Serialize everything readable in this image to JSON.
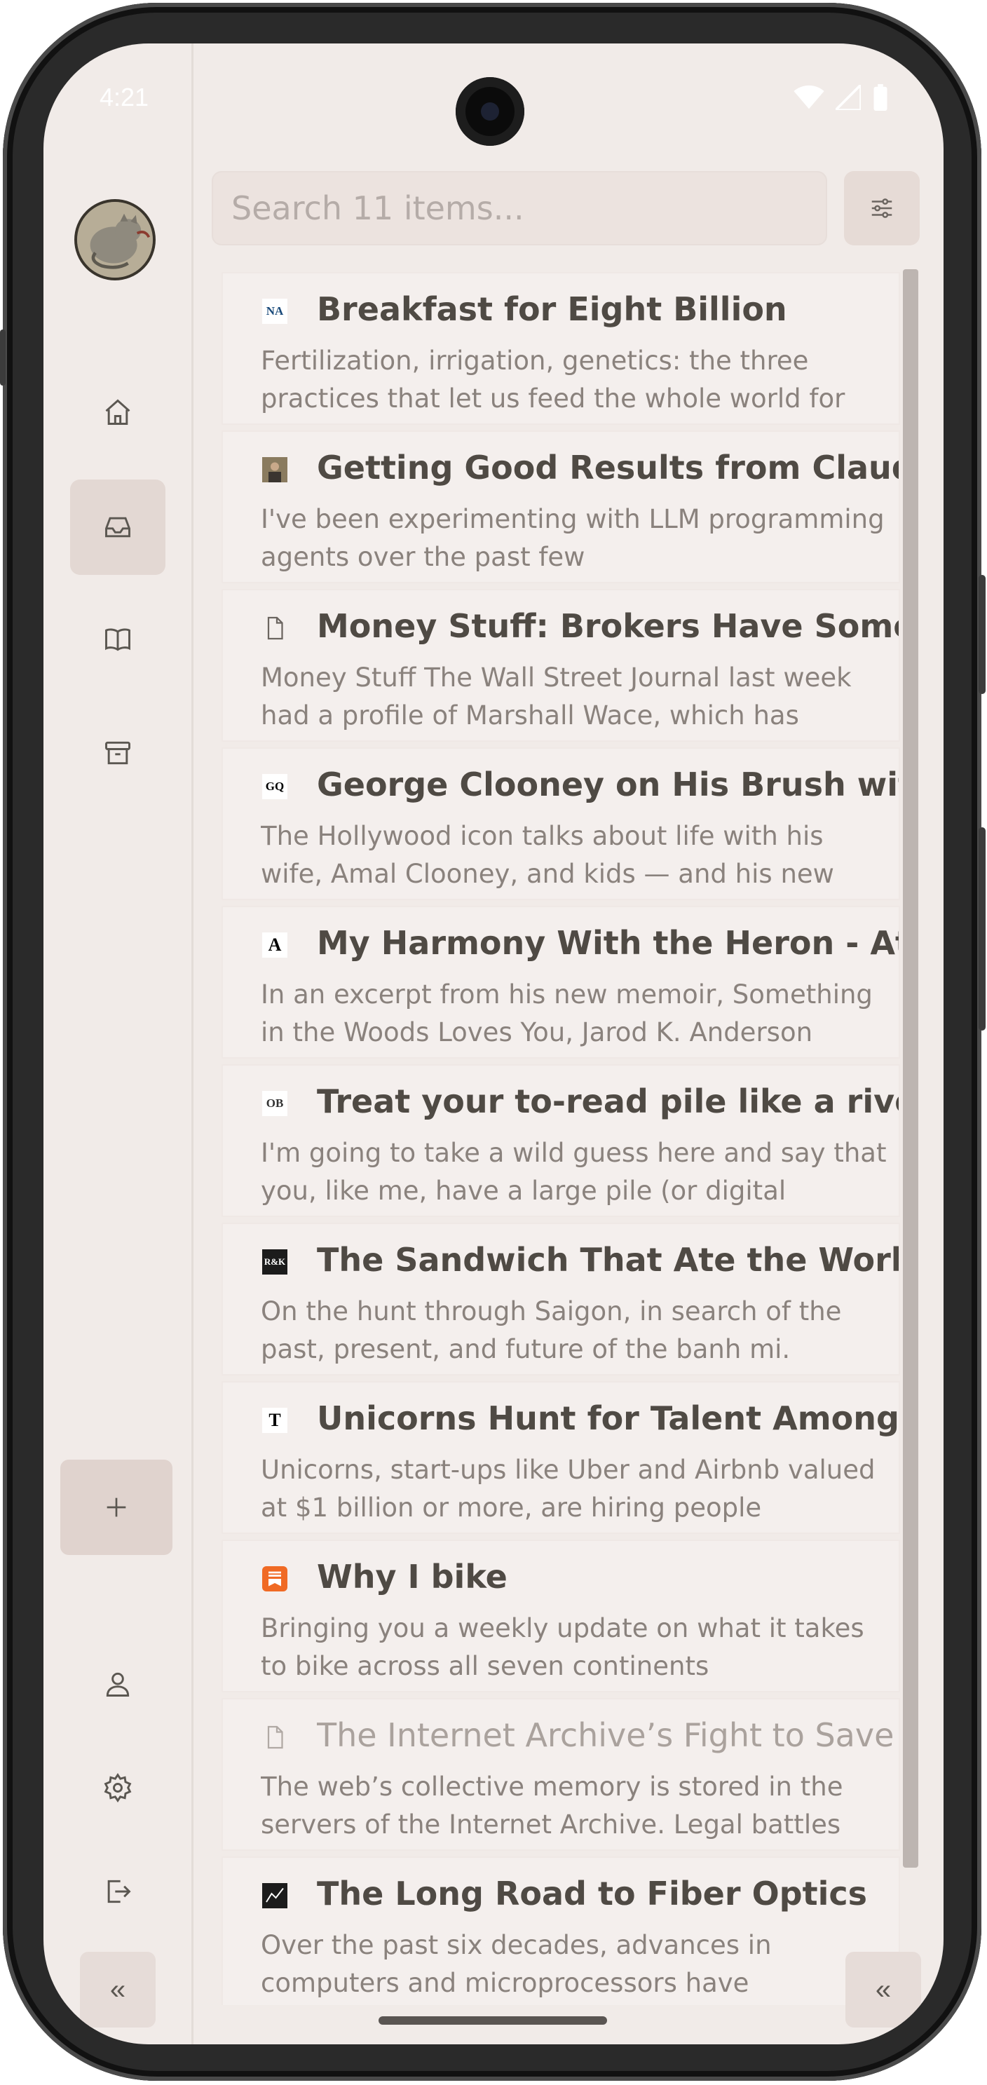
{
  "status_bar": {
    "time": "4:21"
  },
  "search": {
    "placeholder": "Search 11 items..."
  },
  "nav": {
    "home": "home",
    "inbox": "inbox",
    "library": "library",
    "archive": "archive",
    "add": "add",
    "profile": "profile",
    "settings": "settings",
    "logout": "logout"
  },
  "collapse": {
    "left": "«",
    "right": "«"
  },
  "articles": [
    {
      "favicon": "NA",
      "favicon_bg": "#ffffff",
      "favicon_fg": "#1a4a7a",
      "title": "Breakfast for Eight Billion",
      "desc": "Fertilization, irrigation, genetics: the three practices that let us feed the whole world for"
    },
    {
      "favicon": "img",
      "favicon_bg": "#8a7b5f",
      "favicon_fg": "#ffffff",
      "title": "Getting Good Results from Claude Code",
      "desc": "I've been experimenting with LLM programming agents over the past few"
    },
    {
      "favicon": "doc",
      "favicon_bg": "transparent",
      "favicon_fg": "#6b6560",
      "title": "Money Stuff: Brokers Have Some Good",
      "desc": "Money Stuff The Wall Street Journal last week had a profile of Marshall Wace, which has"
    },
    {
      "favicon": "GQ",
      "favicon_bg": "#ffffff",
      "favicon_fg": "#000000",
      "title": "George Clooney on His Brush with Death",
      "desc": "The Hollywood icon talks about life with his wife, Amal Clooney, and kids — and his new"
    },
    {
      "favicon": "A",
      "favicon_bg": "#ffffff",
      "favicon_fg": "#000000",
      "title": "My Harmony With the Heron - Atmos",
      "desc": "In an excerpt from his new memoir, Something in the Woods Loves You, Jarod K. Anderson"
    },
    {
      "favicon": "OB",
      "favicon_bg": "#ffffff",
      "favicon_fg": "#333333",
      "title": "Treat your to-read pile like a river | Oliver",
      "desc": "I'm going to take a wild guess here and say that you, like me, have a large pile (or digital"
    },
    {
      "favicon": "R&K",
      "favicon_bg": "#1c1c1c",
      "favicon_fg": "#ffffff",
      "title": "The Sandwich That Ate the World",
      "desc": "On the hunt through Saigon, in search of the past, present, and future of the banh mi."
    },
    {
      "favicon": "T",
      "favicon_bg": "#ffffff",
      "favicon_fg": "#000000",
      "title": "Unicorns Hunt for Talent Among Silicon",
      "desc": "Unicorns, start-ups like Uber and Airbnb valued at $1 billion or more, are hiring people"
    },
    {
      "favicon": "substack",
      "favicon_bg": "#f06a24",
      "favicon_fg": "#ffffff",
      "title": "Why I bike",
      "desc": "Bringing you a weekly update on what it takes to bike across all seven continents"
    },
    {
      "favicon": "doc",
      "favicon_bg": "transparent",
      "favicon_fg": "#b0a9a4",
      "title": "The Internet Archive’s Fight to Save It",
      "desc": "The web’s collective memory is stored in the servers of the Internet Archive. Legal battles",
      "dim": true
    },
    {
      "favicon": "chart",
      "favicon_bg": "#1c1c1c",
      "favicon_fg": "#ffffff",
      "title": "The Long Road to Fiber Optics",
      "desc": "Over the past six decades, advances in computers and microprocessors have"
    }
  ]
}
